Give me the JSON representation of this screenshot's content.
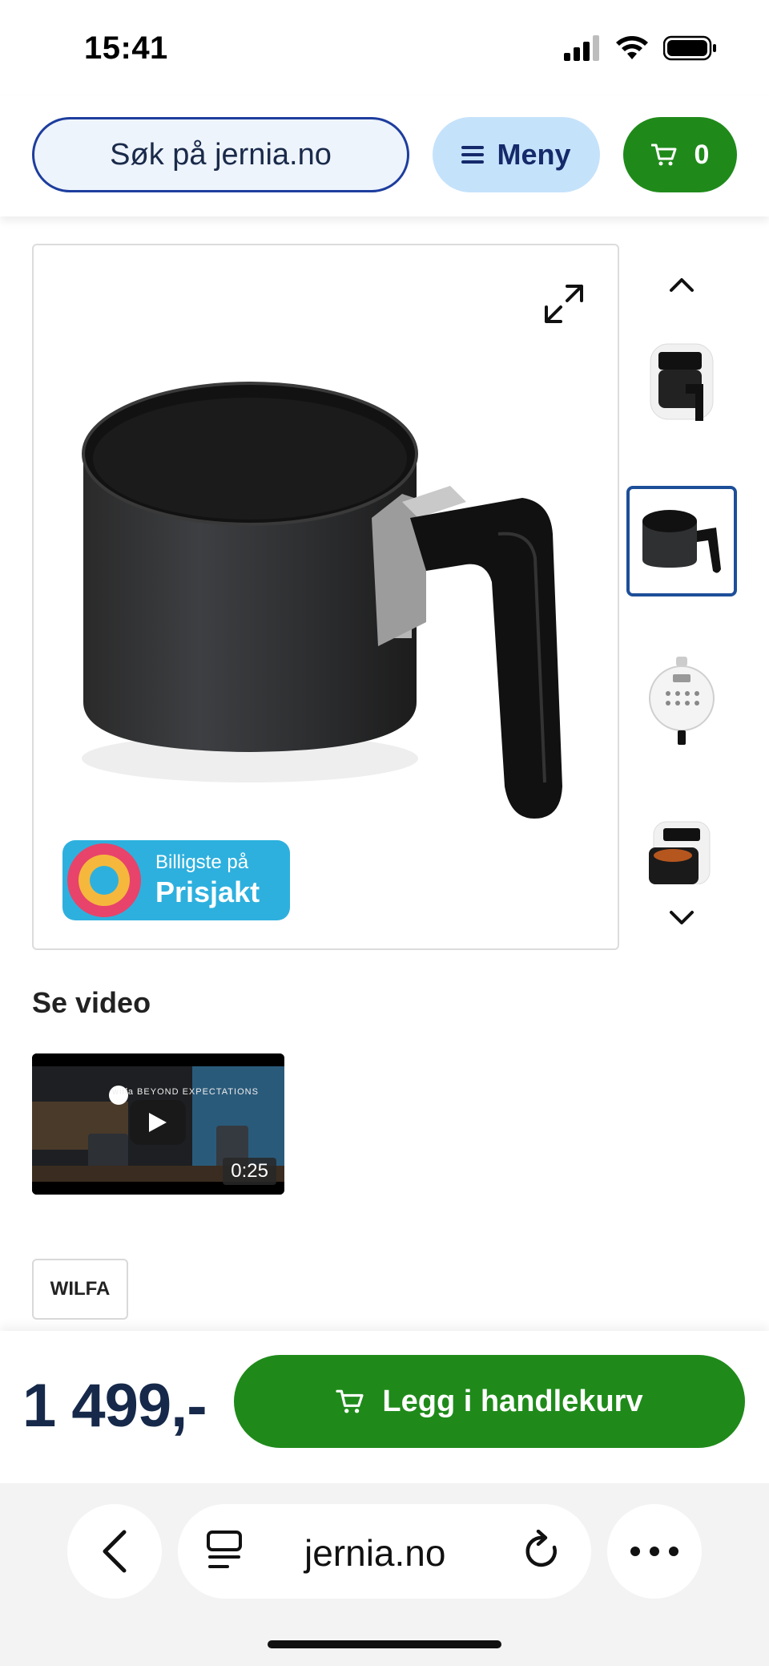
{
  "status_bar": {
    "time": "15:41",
    "icons": [
      "signal-icon",
      "wifi-icon",
      "battery-icon"
    ]
  },
  "header": {
    "search_label": "Søk på jernia.no",
    "menu_label": "Meny",
    "cart_count": "0"
  },
  "gallery": {
    "expand_icon": "expand-icon",
    "badge_small": "Billigste på",
    "badge_big": "Prisjakt",
    "thumbnails": [
      "airfryer-front",
      "basket",
      "control-panel",
      "airfryer-open"
    ],
    "selected_index": 1
  },
  "video": {
    "heading": "Se video",
    "brand_overlay": "wilfa   BEYOND EXPECTATIONS",
    "duration": "0:25"
  },
  "brand": {
    "name": "WILFA"
  },
  "buy_bar": {
    "price": "1 499,-",
    "add_to_cart_label": "Legg i handlekurv"
  },
  "browser": {
    "url": "jernia.no"
  },
  "colors": {
    "primary_green": "#1f8a1a",
    "navy": "#16294a",
    "light_blue": "#c5e2fb",
    "prisjakt_blue": "#2eb0de"
  }
}
